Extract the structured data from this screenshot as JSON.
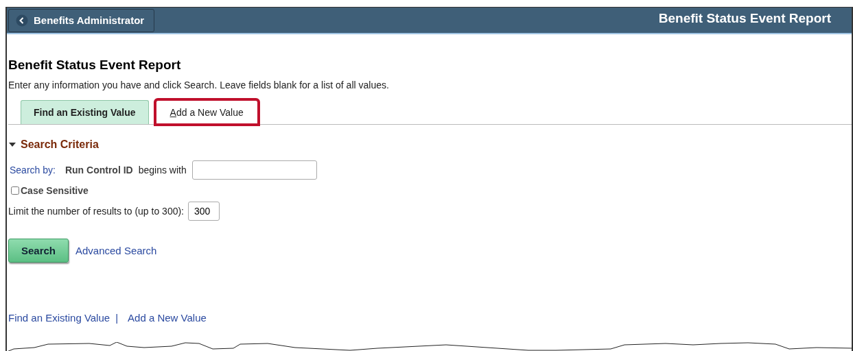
{
  "header": {
    "back_button": "Benefits Administrator",
    "title": "Benefit Status Event Report"
  },
  "page_title": "Benefit Status Event Report",
  "instructions": "Enter any information you have and click Search. Leave fields blank for a list of all values.",
  "tabs": [
    {
      "label": "Find an Existing Value",
      "selected": true,
      "highlighted": false
    },
    {
      "label": "Add a New Value",
      "selected": false,
      "highlighted": true
    }
  ],
  "search_criteria": {
    "title": "Search Criteria",
    "expanded": true,
    "search_by_label": "Search by:",
    "field_name": "Run Control ID",
    "operator": "begins with",
    "case_sensitive": {
      "label": "Case Sensitive",
      "checked": false
    },
    "limit_label": "Limit the number of results to (up to 300):",
    "limit_value": "300"
  },
  "buttons": {
    "search": "Search",
    "advanced": "Advanced Search"
  },
  "footer_links": [
    "Find an Existing Value",
    "Add a New Value"
  ],
  "footer_separator": "|"
}
